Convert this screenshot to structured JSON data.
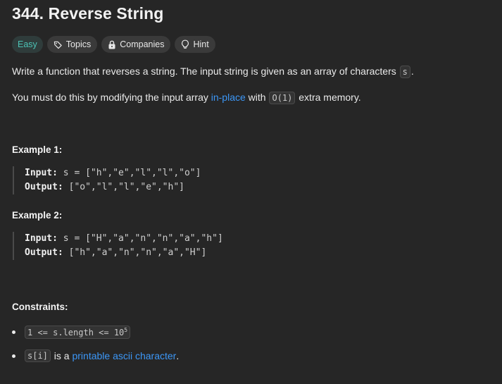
{
  "problem": {
    "title": "344. Reverse String"
  },
  "tags": {
    "difficulty": "Easy",
    "topics": "Topics",
    "companies": "Companies",
    "hint": "Hint"
  },
  "description": {
    "p1_text": "Write a function that reverses a string. The input string is given as an array of characters ",
    "p1_code": "s",
    "p1_end": ".",
    "p2_before": "You must do this by modifying the input array ",
    "p2_link": "in-place",
    "p2_mid": " with ",
    "p2_code": "O(1)",
    "p2_end": " extra memory."
  },
  "examples": [
    {
      "heading": "Example 1:",
      "input_label": "Input:",
      "input_value": " s = [\"h\",\"e\",\"l\",\"l\",\"o\"]",
      "output_label": "Output:",
      "output_value": " [\"o\",\"l\",\"l\",\"e\",\"h\"]"
    },
    {
      "heading": "Example 2:",
      "input_label": "Input:",
      "input_value": " s = [\"H\",\"a\",\"n\",\"n\",\"a\",\"h\"]",
      "output_label": "Output:",
      "output_value": " [\"h\",\"a\",\"n\",\"n\",\"a\",\"H\"]"
    }
  ],
  "constraints": {
    "heading": "Constraints:",
    "c1_code": "1 <= s.length <= 10",
    "c1_sup": "5",
    "c2_code": "s[i]",
    "c2_mid": " is a ",
    "c2_link": "printable ascii character",
    "c2_end": "."
  }
}
